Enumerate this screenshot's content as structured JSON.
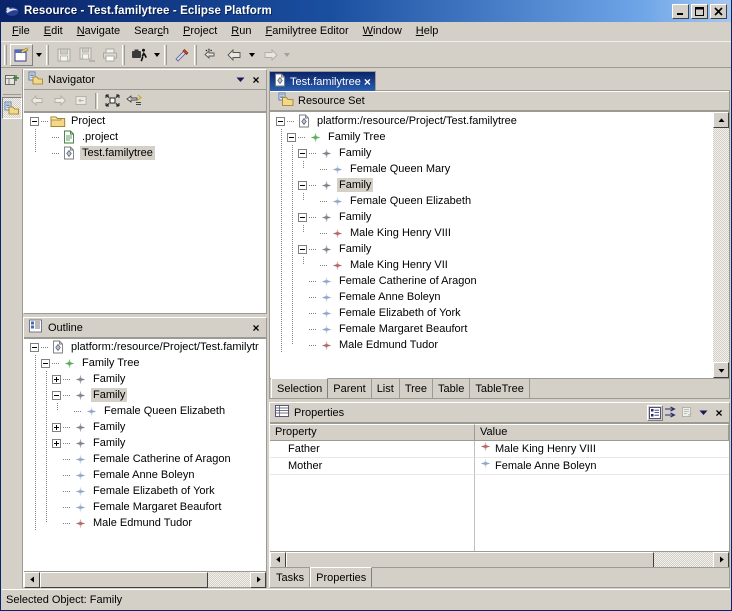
{
  "window": {
    "title": "Resource - Test.familytree - Eclipse Platform",
    "icon": "eclipse-icon",
    "minimize_label": "Minimize",
    "maximize_label": "Maximize",
    "close_label": "Close"
  },
  "menubar": {
    "items": [
      {
        "label": "File",
        "mnemonic": "F"
      },
      {
        "label": "Edit",
        "mnemonic": "E"
      },
      {
        "label": "Navigate",
        "mnemonic": "N"
      },
      {
        "label": "Search",
        "mnemonic": "c"
      },
      {
        "label": "Project",
        "mnemonic": "P"
      },
      {
        "label": "Run",
        "mnemonic": "R"
      },
      {
        "label": "Familytree Editor",
        "mnemonic": "F"
      },
      {
        "label": "Window",
        "mnemonic": "W"
      },
      {
        "label": "Help",
        "mnemonic": "H"
      }
    ]
  },
  "toolbar": {
    "buttons": [
      {
        "name": "new-wizard-button",
        "tooltip": "New",
        "enabled": true
      },
      {
        "name": "new-dropdown-arrow",
        "tooltip": "New menu",
        "enabled": true
      },
      {
        "name": "save-button",
        "tooltip": "Save",
        "enabled": false
      },
      {
        "name": "save-all-button",
        "tooltip": "Save All",
        "enabled": false
      },
      {
        "name": "print-button",
        "tooltip": "Print",
        "enabled": false
      },
      {
        "name": "run-button",
        "tooltip": "Run",
        "enabled": true
      },
      {
        "name": "run-dropdown-arrow",
        "tooltip": "Run menu",
        "enabled": true
      },
      {
        "name": "external-tools-button",
        "tooltip": "External Tools",
        "enabled": true
      },
      {
        "name": "next-annotation-button",
        "tooltip": "Next Annotation",
        "enabled": true
      },
      {
        "name": "back-button",
        "tooltip": "Back",
        "enabled": true
      },
      {
        "name": "back-dropdown-arrow",
        "tooltip": "Back menu",
        "enabled": true
      },
      {
        "name": "forward-button",
        "tooltip": "Forward",
        "enabled": false
      },
      {
        "name": "forward-dropdown-arrow",
        "tooltip": "Forward menu",
        "enabled": false
      }
    ]
  },
  "leftbar": {
    "buttons": [
      {
        "name": "open-perspective-button",
        "tooltip": "Open Perspective"
      },
      {
        "name": "resource-perspective-button",
        "tooltip": "Resource",
        "pressed": true
      }
    ]
  },
  "navigator": {
    "title": "Navigator",
    "icon": "navigator-icon",
    "menu_label": "View Menu",
    "close_label": "Close",
    "toolbar": [
      {
        "name": "back-button",
        "enabled": false
      },
      {
        "name": "forward-button",
        "enabled": false
      },
      {
        "name": "up-button",
        "enabled": false
      },
      {
        "name": "collapse-all-button",
        "enabled": true
      },
      {
        "name": "link-with-editor-button",
        "enabled": true
      }
    ],
    "tree": [
      {
        "label": "Project",
        "depth": 0,
        "expander": "minus",
        "icon": "folder-icon",
        "selected": false
      },
      {
        "label": ".project",
        "depth": 1,
        "expander": "none",
        "icon": "file-icon",
        "selected": false
      },
      {
        "label": "Test.familytree",
        "depth": 1,
        "expander": "none",
        "icon": "familytree-file-icon",
        "selected": true
      }
    ]
  },
  "outline": {
    "title": "Outline",
    "icon": "outline-icon",
    "close_label": "Close",
    "tree": [
      {
        "label": "platform:/resource/Project/Test.familytr",
        "depth": 0,
        "expander": "minus",
        "icon": "resource-icon",
        "selected": false
      },
      {
        "label": "Family Tree",
        "depth": 1,
        "expander": "minus",
        "icon": "green-diamond-icon",
        "selected": false
      },
      {
        "label": "Family",
        "depth": 2,
        "expander": "plus",
        "icon": "gray-diamond-icon",
        "selected": false
      },
      {
        "label": "Family",
        "depth": 2,
        "expander": "minus",
        "icon": "gray-diamond-icon",
        "selected": true
      },
      {
        "label": "Female Queen Elizabeth",
        "depth": 3,
        "expander": "none",
        "icon": "blue-diamond-icon",
        "selected": false
      },
      {
        "label": "Family",
        "depth": 2,
        "expander": "plus",
        "icon": "gray-diamond-icon",
        "selected": false
      },
      {
        "label": "Family",
        "depth": 2,
        "expander": "plus",
        "icon": "gray-diamond-icon",
        "selected": false
      },
      {
        "label": "Female Catherine of Aragon",
        "depth": 2,
        "expander": "none",
        "icon": "blue-diamond-icon",
        "selected": false
      },
      {
        "label": "Female Anne Boleyn",
        "depth": 2,
        "expander": "none",
        "icon": "blue-diamond-icon",
        "selected": false
      },
      {
        "label": "Female Elizabeth of York",
        "depth": 2,
        "expander": "none",
        "icon": "blue-diamond-icon",
        "selected": false
      },
      {
        "label": "Female Margaret Beaufort",
        "depth": 2,
        "expander": "none",
        "icon": "blue-diamond-icon",
        "selected": false
      },
      {
        "label": "Male Edmund Tudor",
        "depth": 2,
        "expander": "none",
        "icon": "red-diamond-icon",
        "selected": false
      }
    ]
  },
  "editor": {
    "tab": {
      "label": "Test.familytree",
      "icon": "familytree-file-icon",
      "close_label": "Close"
    },
    "resource_set": {
      "label": "Resource Set",
      "icon": "resource-set-icon"
    },
    "tree": [
      {
        "label": "platform:/resource/Project/Test.familytree",
        "depth": 0,
        "expander": "minus",
        "icon": "resource-icon",
        "selected": false
      },
      {
        "label": "Family Tree",
        "depth": 1,
        "expander": "minus",
        "icon": "green-diamond-icon",
        "selected": false
      },
      {
        "label": "Family",
        "depth": 2,
        "expander": "minus",
        "icon": "gray-diamond-icon",
        "selected": false
      },
      {
        "label": "Female Queen Mary",
        "depth": 3,
        "expander": "none",
        "icon": "blue-diamond-icon",
        "selected": false
      },
      {
        "label": "Family",
        "depth": 2,
        "expander": "minus",
        "icon": "gray-diamond-icon",
        "selected": true
      },
      {
        "label": "Female Queen Elizabeth",
        "depth": 3,
        "expander": "none",
        "icon": "blue-diamond-icon",
        "selected": false
      },
      {
        "label": "Family",
        "depth": 2,
        "expander": "minus",
        "icon": "gray-diamond-icon",
        "selected": false
      },
      {
        "label": "Male King Henry VIII",
        "depth": 3,
        "expander": "none",
        "icon": "red-diamond-icon",
        "selected": false
      },
      {
        "label": "Family",
        "depth": 2,
        "expander": "minus",
        "icon": "gray-diamond-icon",
        "selected": false
      },
      {
        "label": "Male King Henry VII",
        "depth": 3,
        "expander": "none",
        "icon": "red-diamond-icon",
        "selected": false
      },
      {
        "label": "Female Catherine of Aragon",
        "depth": 2,
        "expander": "none",
        "icon": "blue-diamond-icon",
        "selected": false
      },
      {
        "label": "Female Anne Boleyn",
        "depth": 2,
        "expander": "none",
        "icon": "blue-diamond-icon",
        "selected": false
      },
      {
        "label": "Female Elizabeth of York",
        "depth": 2,
        "expander": "none",
        "icon": "blue-diamond-icon",
        "selected": false
      },
      {
        "label": "Female Margaret Beaufort",
        "depth": 2,
        "expander": "none",
        "icon": "blue-diamond-icon",
        "selected": false
      },
      {
        "label": "Male Edmund Tudor",
        "depth": 2,
        "expander": "none",
        "icon": "red-diamond-icon",
        "selected": false
      }
    ],
    "bottom_tabs": [
      {
        "label": "Selection",
        "active": true
      },
      {
        "label": "Parent",
        "active": false
      },
      {
        "label": "List",
        "active": false
      },
      {
        "label": "Tree",
        "active": false
      },
      {
        "label": "Table",
        "active": false
      },
      {
        "label": "TableTree",
        "active": false
      }
    ]
  },
  "properties": {
    "title": "Properties",
    "icon": "properties-icon",
    "toolbar": [
      {
        "name": "show-categories-button",
        "pressed": true
      },
      {
        "name": "show-advanced-properties-button",
        "pressed": false
      },
      {
        "name": "restore-default-value-button",
        "enabled": false
      },
      {
        "name": "view-menu-button",
        "enabled": true
      },
      {
        "name": "close-button",
        "enabled": true
      }
    ],
    "columns": [
      "Property",
      "Value"
    ],
    "rows": [
      {
        "property": "Father",
        "value": "Male King Henry VIII",
        "value_icon": "red-diamond-icon"
      },
      {
        "property": "Mother",
        "value": "Female Anne Boleyn",
        "value_icon": "blue-diamond-icon"
      }
    ],
    "bottom_tabs": [
      {
        "label": "Tasks",
        "active": false
      },
      {
        "label": "Properties",
        "active": true
      }
    ]
  },
  "statusbar": {
    "text": "Selected Object: Family"
  },
  "colors": {
    "title_bar_start": "#0a246a",
    "title_bar_end": "#a6c8f0",
    "chrome": "#d4d0c8",
    "selection": "#d4d0c8",
    "green_diamond": "#6db56d",
    "gray_diamond": "#8b8b99",
    "blue_diamond": "#9fb6d8",
    "red_diamond": "#b46a6a"
  }
}
